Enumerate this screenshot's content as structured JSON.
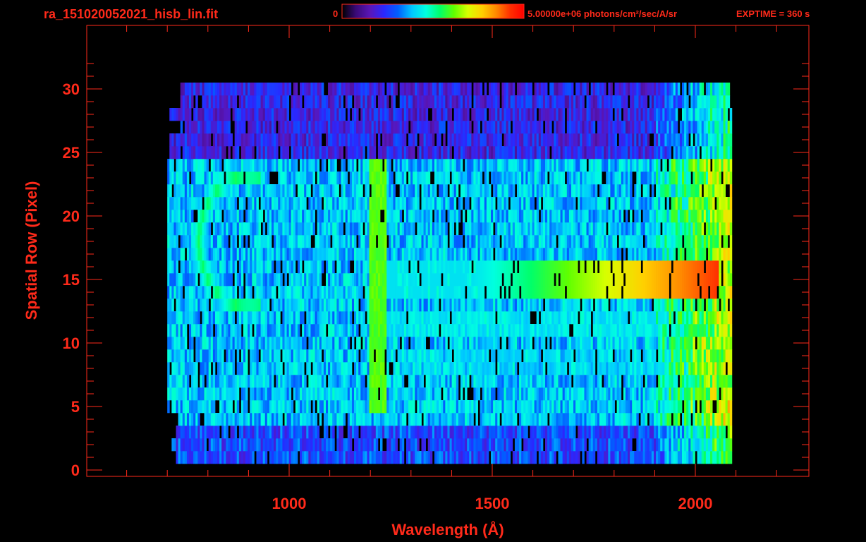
{
  "header": {
    "filename": "ra_151020052021_hisb_lin.fit",
    "colorbar_min_label": "0",
    "colorbar_max_label": "5.00000e+06 photons/cm²/sec/A/sr",
    "exptime_label": "EXPTIME = 360 s"
  },
  "colors": {
    "axis": "#ff2a1a",
    "background": "#000000",
    "colormap": [
      "#000000",
      "#3a0a78",
      "#5a16b8",
      "#2a28ff",
      "#0060ff",
      "#00c8ff",
      "#00ffe0",
      "#00ff6a",
      "#60ff00",
      "#d8ff00",
      "#ffd000",
      "#ff8a00",
      "#ff3000",
      "#ff0000"
    ]
  },
  "chart_data": {
    "type": "heatmap",
    "title": "ra_151020052021_hisb_lin.fit",
    "xlabel": "Wavelength (Å)",
    "ylabel": "Spatial Row (Pixel)",
    "xlim": [
      520,
      2290
    ],
    "ylim": [
      -0.4,
      32
    ],
    "xticks": [
      1000,
      1500,
      2000
    ],
    "yticks": [
      0,
      5,
      10,
      15,
      20,
      25,
      30
    ],
    "colorbar": {
      "min": 0,
      "max": 5000000,
      "units": "photons/cm²/sec/A/sr"
    },
    "data_extent": {
      "x": [
        700,
        2090
      ],
      "y": [
        0,
        30
      ]
    },
    "features": [
      {
        "kind": "arc",
        "x_range": [
          770,
          920
        ],
        "y_range": [
          13,
          23
        ],
        "level": 0.55
      },
      {
        "kind": "vertical_band",
        "x": 1215,
        "y_range": [
          5,
          24
        ],
        "level": 0.6
      },
      {
        "kind": "horizontal_band",
        "x_range": [
          1550,
          2050
        ],
        "y": 15,
        "peak_level": 0.9
      },
      {
        "kind": "horizontal_band",
        "x_range": [
          1200,
          2050
        ],
        "y": 12,
        "peak_level": 0.45
      },
      {
        "kind": "horizontal_band",
        "x_range": [
          1220,
          2050
        ],
        "y": 8,
        "peak_level": 0.4
      }
    ]
  }
}
